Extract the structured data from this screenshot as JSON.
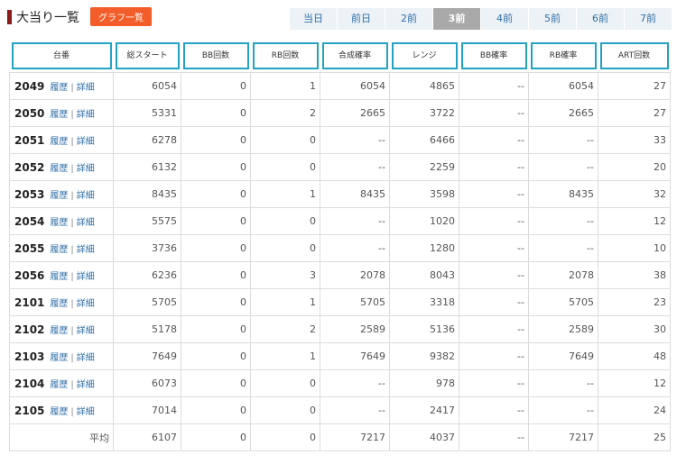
{
  "header": {
    "title": "大当り一覧",
    "graph_button": "グラフ一覧",
    "date_tabs": [
      "当日",
      "前日",
      "2前",
      "3前",
      "4前",
      "5前",
      "6前",
      "7前"
    ],
    "active_tab": "3前"
  },
  "columns": [
    "台番",
    "総スタート",
    "BB回数",
    "RB回数",
    "合成確率",
    "レンジ",
    "BB確率",
    "RB確率",
    "ART回数"
  ],
  "row_links": {
    "history": "履歴",
    "detail": "詳細",
    "separator": "|"
  },
  "rows": [
    {
      "machine": "2049",
      "start": "6054",
      "bb": "0",
      "rb": "1",
      "combined": "6054",
      "range": "4865",
      "bb_rate": "--",
      "rb_rate": "6054",
      "art": "27"
    },
    {
      "machine": "2050",
      "start": "5331",
      "bb": "0",
      "rb": "2",
      "combined": "2665",
      "range": "3722",
      "bb_rate": "--",
      "rb_rate": "2665",
      "art": "27"
    },
    {
      "machine": "2051",
      "start": "6278",
      "bb": "0",
      "rb": "0",
      "combined": "--",
      "range": "6466",
      "bb_rate": "--",
      "rb_rate": "--",
      "art": "33"
    },
    {
      "machine": "2052",
      "start": "6132",
      "bb": "0",
      "rb": "0",
      "combined": "--",
      "range": "2259",
      "bb_rate": "--",
      "rb_rate": "--",
      "art": "20"
    },
    {
      "machine": "2053",
      "start": "8435",
      "bb": "0",
      "rb": "1",
      "combined": "8435",
      "range": "3598",
      "bb_rate": "--",
      "rb_rate": "8435",
      "art": "32"
    },
    {
      "machine": "2054",
      "start": "5575",
      "bb": "0",
      "rb": "0",
      "combined": "--",
      "range": "1020",
      "bb_rate": "--",
      "rb_rate": "--",
      "art": "12"
    },
    {
      "machine": "2055",
      "start": "3736",
      "bb": "0",
      "rb": "0",
      "combined": "--",
      "range": "1280",
      "bb_rate": "--",
      "rb_rate": "--",
      "art": "10"
    },
    {
      "machine": "2056",
      "start": "6236",
      "bb": "0",
      "rb": "3",
      "combined": "2078",
      "range": "8043",
      "bb_rate": "--",
      "rb_rate": "2078",
      "art": "38"
    },
    {
      "machine": "2101",
      "start": "5705",
      "bb": "0",
      "rb": "1",
      "combined": "5705",
      "range": "3318",
      "bb_rate": "--",
      "rb_rate": "5705",
      "art": "23"
    },
    {
      "machine": "2102",
      "start": "5178",
      "bb": "0",
      "rb": "2",
      "combined": "2589",
      "range": "5136",
      "bb_rate": "--",
      "rb_rate": "2589",
      "art": "30"
    },
    {
      "machine": "2103",
      "start": "7649",
      "bb": "0",
      "rb": "1",
      "combined": "7649",
      "range": "9382",
      "bb_rate": "--",
      "rb_rate": "7649",
      "art": "48"
    },
    {
      "machine": "2104",
      "start": "6073",
      "bb": "0",
      "rb": "0",
      "combined": "--",
      "range": "978",
      "bb_rate": "--",
      "rb_rate": "--",
      "art": "12"
    },
    {
      "machine": "2105",
      "start": "7014",
      "bb": "0",
      "rb": "0",
      "combined": "--",
      "range": "2417",
      "bb_rate": "--",
      "rb_rate": "--",
      "art": "24"
    }
  ],
  "average": {
    "label": "平均",
    "start": "6107",
    "bb": "0",
    "rb": "0",
    "combined": "7217",
    "range": "4037",
    "bb_rate": "--",
    "rb_rate": "7217",
    "art": "25"
  },
  "colors": {
    "header_border": "#22a3c3",
    "graph_button": "#f25d2a",
    "title_mark": "#8b1a1a",
    "link": "#2f6fa7",
    "active_tab": "#a9a9a9"
  }
}
